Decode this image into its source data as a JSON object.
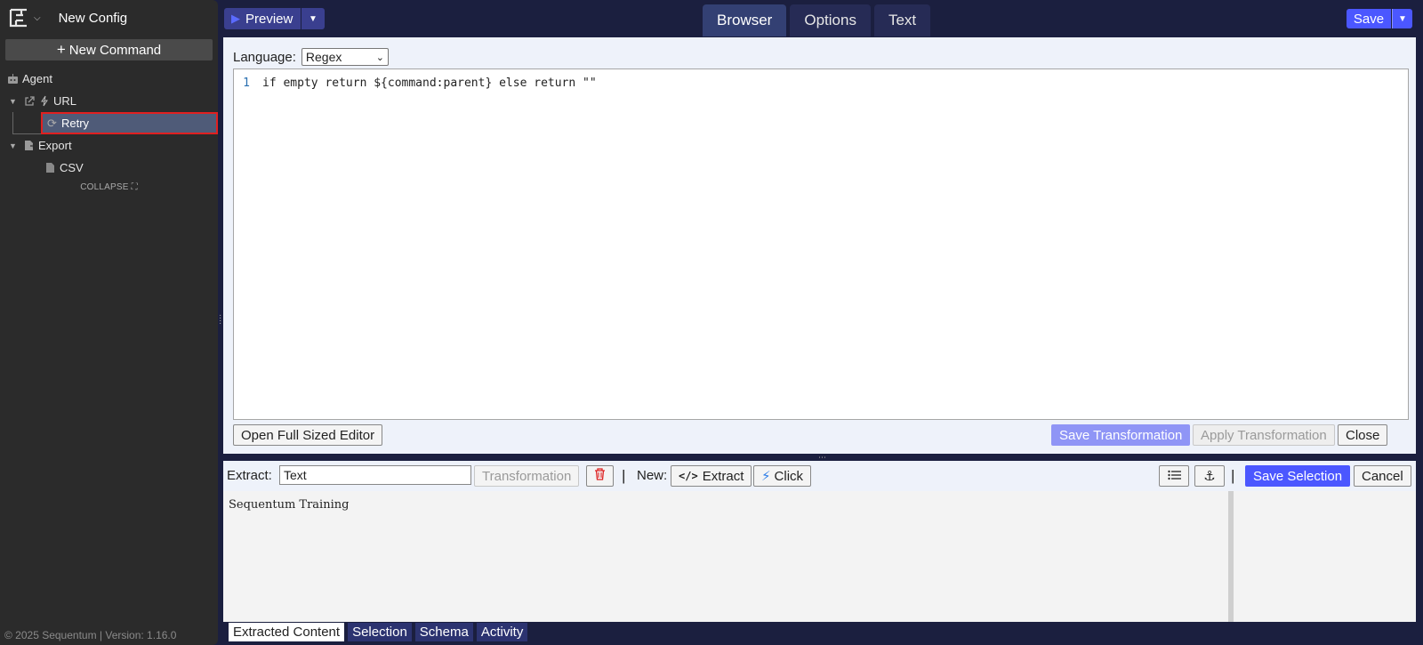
{
  "sidebar": {
    "config_title": "New Config",
    "new_command_label": "New Command",
    "tree": [
      {
        "label": "Agent"
      },
      {
        "label": "URL"
      },
      {
        "label": "Retry"
      },
      {
        "label": "Export"
      },
      {
        "label": "CSV"
      }
    ],
    "collapse_label": "COLLAPSE",
    "footer": "© 2025 Sequentum | Version: 1.16.0"
  },
  "topbar": {
    "preview_label": "Preview",
    "tabs": [
      {
        "label": "Browser"
      },
      {
        "label": "Options"
      },
      {
        "label": "Text"
      }
    ],
    "save_label": "Save"
  },
  "editor": {
    "language_label": "Language:",
    "language_value": "Regex",
    "line_number": "1",
    "code": "if empty return ${command:parent} else return \"\"",
    "open_full_label": "Open Full Sized Editor",
    "save_transformation_label": "Save Transformation",
    "apply_transformation_label": "Apply Transformation",
    "close_label": "Close"
  },
  "extract_toolbar": {
    "extract_label": "Extract:",
    "extract_value": "Text",
    "transformation_label": "Transformation",
    "new_label": "New:",
    "extract_btn_label": "Extract",
    "click_btn_label": "Click",
    "save_selection_label": "Save Selection",
    "cancel_label": "Cancel"
  },
  "content": {
    "text": "Sequentum Training"
  },
  "bottom_tabs": [
    {
      "label": "Extracted Content"
    },
    {
      "label": "Selection"
    },
    {
      "label": "Schema"
    },
    {
      "label": "Activity"
    }
  ],
  "colors": {
    "accent": "#4b57ff",
    "selected_outline": "#e02020",
    "sidebar_bg": "#2b2b2b",
    "app_bg": "#1b1f3f"
  }
}
